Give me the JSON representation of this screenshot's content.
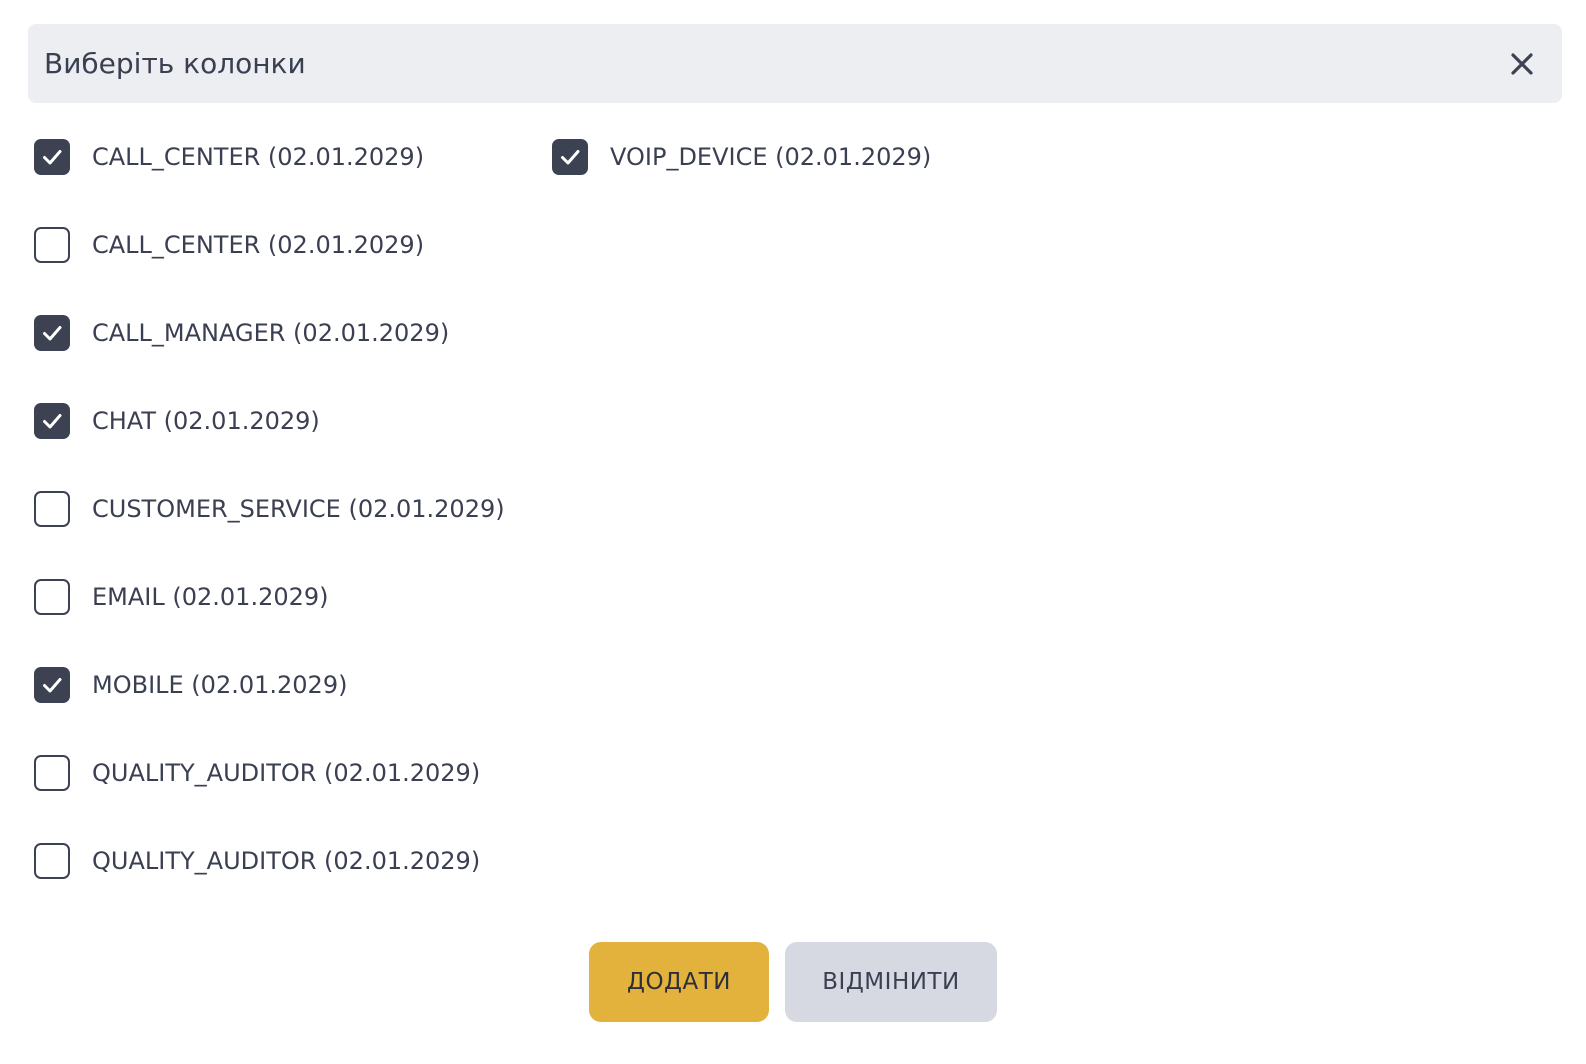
{
  "dialog": {
    "title": "Виберіть колонки",
    "close_icon": "close-icon"
  },
  "columns": {
    "left": [
      {
        "label": "CALL_CENTER (02.01.2029)",
        "checked": true
      },
      {
        "label": "CALL_CENTER (02.01.2029)",
        "checked": false
      },
      {
        "label": "CALL_MANAGER (02.01.2029)",
        "checked": true
      },
      {
        "label": "CHAT (02.01.2029)",
        "checked": true
      },
      {
        "label": "CUSTOMER_SERVICE (02.01.2029)",
        "checked": false
      },
      {
        "label": "EMAIL (02.01.2029)",
        "checked": false
      },
      {
        "label": "MOBILE (02.01.2029)",
        "checked": true
      },
      {
        "label": "QUALITY_AUDITOR (02.01.2029)",
        "checked": false
      },
      {
        "label": "QUALITY_AUDITOR (02.01.2029)",
        "checked": false
      }
    ],
    "right": [
      {
        "label": "VOIP_DEVICE (02.01.2029)",
        "checked": true
      }
    ]
  },
  "actions": {
    "add_label": "ДОДАТИ",
    "cancel_label": "ВІДМІНИТИ"
  },
  "colors": {
    "header_bg": "#edeef2",
    "checkbox_checked": "#3d4253",
    "add_button": "#e2b23c",
    "cancel_button": "#d6d8e2",
    "text": "#3a3f52"
  }
}
